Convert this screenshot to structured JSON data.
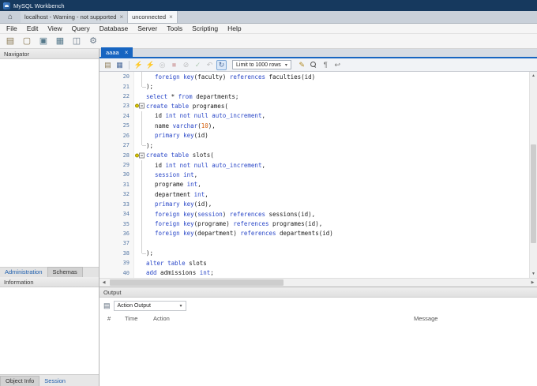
{
  "colors": {
    "titlebar": "#16395e",
    "accent": "#1765c1",
    "keyword": "#2b48c8",
    "number": "#d35c08",
    "plain": "#1a1a1a",
    "line_number": "#5b7ca8",
    "marker": "#dcc705"
  },
  "titlebar": {
    "title": "MySQL Workbench"
  },
  "home": {
    "icon": "⌂"
  },
  "window_tabs": [
    {
      "label": "localhost - Warning - not supported",
      "close": "×",
      "active": false
    },
    {
      "label": "unconnected",
      "close": "×",
      "active": true
    }
  ],
  "menubar": [
    "File",
    "Edit",
    "View",
    "Query",
    "Database",
    "Server",
    "Tools",
    "Scripting",
    "Help"
  ],
  "main_toolbar": [
    {
      "name": "new-query-tab-icon",
      "glyph": "▤",
      "color": "#8a7a55"
    },
    {
      "name": "open-sql-script-icon",
      "glyph": "▢",
      "color": "#8a7a55"
    },
    {
      "name": "create-schema-icon",
      "glyph": "▣",
      "color": "#55788a"
    },
    {
      "name": "create-table-icon",
      "glyph": "▦",
      "color": "#55788a"
    },
    {
      "name": "server-status-icon",
      "glyph": "◫",
      "color": "#6a7a8a"
    },
    {
      "name": "preferences-icon",
      "glyph": "⚙",
      "color": "#6a7a8a"
    }
  ],
  "sidebar": {
    "navigator_title": "Navigator",
    "navigator_tabs": [
      {
        "label": "Administration",
        "style": "link"
      },
      {
        "label": "Schemas",
        "style": "plain"
      }
    ],
    "information_title": "Information",
    "bottom_tabs": [
      {
        "label": "Object Info",
        "style": "plain"
      },
      {
        "label": "Session",
        "style": "link"
      }
    ]
  },
  "editor": {
    "tab": {
      "label": "aaaa",
      "close": "×"
    },
    "toolbar": {
      "file_icons": [
        {
          "name": "open-script-icon",
          "glyph": "▤",
          "state": "normal",
          "color": "#8a7a55"
        },
        {
          "name": "save-script-icon",
          "glyph": "▦",
          "state": "normal",
          "color": "#4a6a9a"
        }
      ],
      "exec_icons": [
        {
          "name": "execute-icon",
          "glyph": "⚡",
          "state": "normal",
          "color": "#d99c00"
        },
        {
          "name": "execute-current-icon",
          "glyph": "⚡",
          "state": "normal",
          "color": "#d99c00"
        },
        {
          "name": "explain-icon",
          "glyph": "◎",
          "state": "disabled",
          "color": "#666666"
        },
        {
          "name": "stop-icon",
          "glyph": "■",
          "state": "disabled",
          "color": "#b05050"
        },
        {
          "name": "stop-on-error-icon",
          "glyph": "⊘",
          "state": "disabled",
          "color": "#666666"
        },
        {
          "name": "commit-icon",
          "glyph": "✓",
          "state": "disabled",
          "color": "#4a8a4a"
        },
        {
          "name": "rollback-icon",
          "glyph": "↶",
          "state": "disabled",
          "color": "#666666"
        },
        {
          "name": "autocommit-icon",
          "glyph": "↻",
          "state": "active",
          "color": "#4a6a9a"
        }
      ],
      "limit": {
        "label": "Limit to 1000 rows",
        "caret": "▾"
      },
      "view_icons": [
        {
          "name": "beautify-icon",
          "glyph": "✎",
          "state": "normal",
          "color": "#b08820"
        },
        {
          "name": "find-icon",
          "shape": "magnifier",
          "state": "normal",
          "color": "#555555"
        },
        {
          "name": "invisible-chars-icon",
          "glyph": "¶",
          "state": "normal",
          "color": "#777777"
        },
        {
          "name": "wrap-text-icon",
          "glyph": "↩",
          "state": "normal",
          "color": "#777777"
        }
      ]
    },
    "lines": [
      {
        "n": 20,
        "ind": 1,
        "fold": "body",
        "mark": false,
        "t": [
          [
            "k",
            "foreign key"
          ],
          [
            "p",
            "(faculty) "
          ],
          [
            "k",
            "references"
          ],
          [
            "p",
            " faculties(id)"
          ]
        ]
      },
      {
        "n": 21,
        "ind": 0,
        "fold": "end",
        "mark": false,
        "t": [
          [
            "p",
            ");"
          ]
        ]
      },
      {
        "n": 22,
        "ind": 0,
        "fold": "",
        "mark": false,
        "t": [
          [
            "k",
            "select"
          ],
          [
            "p",
            " * "
          ],
          [
            "k",
            "from"
          ],
          [
            "p",
            " departments;"
          ]
        ]
      },
      {
        "n": 23,
        "ind": 0,
        "fold": "start",
        "mark": true,
        "t": [
          [
            "k",
            "create table"
          ],
          [
            "p",
            " programes("
          ]
        ]
      },
      {
        "n": 24,
        "ind": 1,
        "fold": "body",
        "mark": false,
        "t": [
          [
            "p",
            "id "
          ],
          [
            "k",
            "int not null auto_increment"
          ],
          [
            "p",
            ","
          ]
        ]
      },
      {
        "n": 25,
        "ind": 1,
        "fold": "body",
        "mark": false,
        "t": [
          [
            "p",
            "name "
          ],
          [
            "k",
            "varchar"
          ],
          [
            "p",
            "("
          ],
          [
            "n",
            "10"
          ],
          [
            "p",
            "),"
          ]
        ]
      },
      {
        "n": 26,
        "ind": 1,
        "fold": "body",
        "mark": false,
        "t": [
          [
            "k",
            "primary key"
          ],
          [
            "p",
            "(id)"
          ]
        ]
      },
      {
        "n": 27,
        "ind": 0,
        "fold": "end",
        "mark": false,
        "t": [
          [
            "p",
            ");"
          ]
        ]
      },
      {
        "n": 28,
        "ind": 0,
        "fold": "start",
        "mark": true,
        "t": [
          [
            "k",
            "create table"
          ],
          [
            "p",
            " slots("
          ]
        ]
      },
      {
        "n": 29,
        "ind": 1,
        "fold": "body",
        "mark": false,
        "t": [
          [
            "p",
            "id "
          ],
          [
            "k",
            "int not null auto_increment"
          ],
          [
            "p",
            ","
          ]
        ]
      },
      {
        "n": 30,
        "ind": 1,
        "fold": "body",
        "mark": false,
        "t": [
          [
            "k",
            "session"
          ],
          [
            "p",
            " "
          ],
          [
            "k",
            "int"
          ],
          [
            "p",
            ","
          ]
        ]
      },
      {
        "n": 31,
        "ind": 1,
        "fold": "body",
        "mark": false,
        "t": [
          [
            "p",
            "programe "
          ],
          [
            "k",
            "int"
          ],
          [
            "p",
            ","
          ]
        ]
      },
      {
        "n": 32,
        "ind": 1,
        "fold": "body",
        "mark": false,
        "t": [
          [
            "p",
            "department "
          ],
          [
            "k",
            "int"
          ],
          [
            "p",
            ","
          ]
        ]
      },
      {
        "n": 33,
        "ind": 1,
        "fold": "body",
        "mark": false,
        "t": [
          [
            "k",
            "primary key"
          ],
          [
            "p",
            "(id),"
          ]
        ]
      },
      {
        "n": 34,
        "ind": 1,
        "fold": "body",
        "mark": false,
        "t": [
          [
            "k",
            "foreign key"
          ],
          [
            "p",
            "("
          ],
          [
            "k",
            "session"
          ],
          [
            "p",
            ") "
          ],
          [
            "k",
            "references"
          ],
          [
            "p",
            " sessions(id),"
          ]
        ]
      },
      {
        "n": 35,
        "ind": 1,
        "fold": "body",
        "mark": false,
        "t": [
          [
            "k",
            "foreign key"
          ],
          [
            "p",
            "(programe) "
          ],
          [
            "k",
            "references"
          ],
          [
            "p",
            " programes(id),"
          ]
        ]
      },
      {
        "n": 36,
        "ind": 1,
        "fold": "body",
        "mark": false,
        "t": [
          [
            "k",
            "foreign key"
          ],
          [
            "p",
            "(department) "
          ],
          [
            "k",
            "references"
          ],
          [
            "p",
            " departments(id)"
          ]
        ]
      },
      {
        "n": 37,
        "ind": 0,
        "fold": "body",
        "mark": false,
        "t": []
      },
      {
        "n": 38,
        "ind": 0,
        "fold": "end",
        "mark": false,
        "t": [
          [
            "p",
            ");"
          ]
        ]
      },
      {
        "n": 39,
        "ind": 0,
        "fold": "",
        "mark": false,
        "t": [
          [
            "k",
            "alter table"
          ],
          [
            "p",
            " slots"
          ]
        ]
      },
      {
        "n": 40,
        "ind": 0,
        "fold": "",
        "mark": false,
        "t": [
          [
            "k",
            "add"
          ],
          [
            "p",
            " admissions "
          ],
          [
            "k",
            "int"
          ],
          [
            "p",
            ";"
          ]
        ]
      }
    ]
  },
  "scroll": {
    "up": "▲",
    "down": "▼",
    "left": "◀",
    "right": "▶"
  },
  "output": {
    "title": "Output",
    "view_icon": "▤",
    "view_selector": "Action Output",
    "caret": "▾",
    "columns": [
      "#",
      "Time",
      "Action",
      "Message"
    ]
  }
}
